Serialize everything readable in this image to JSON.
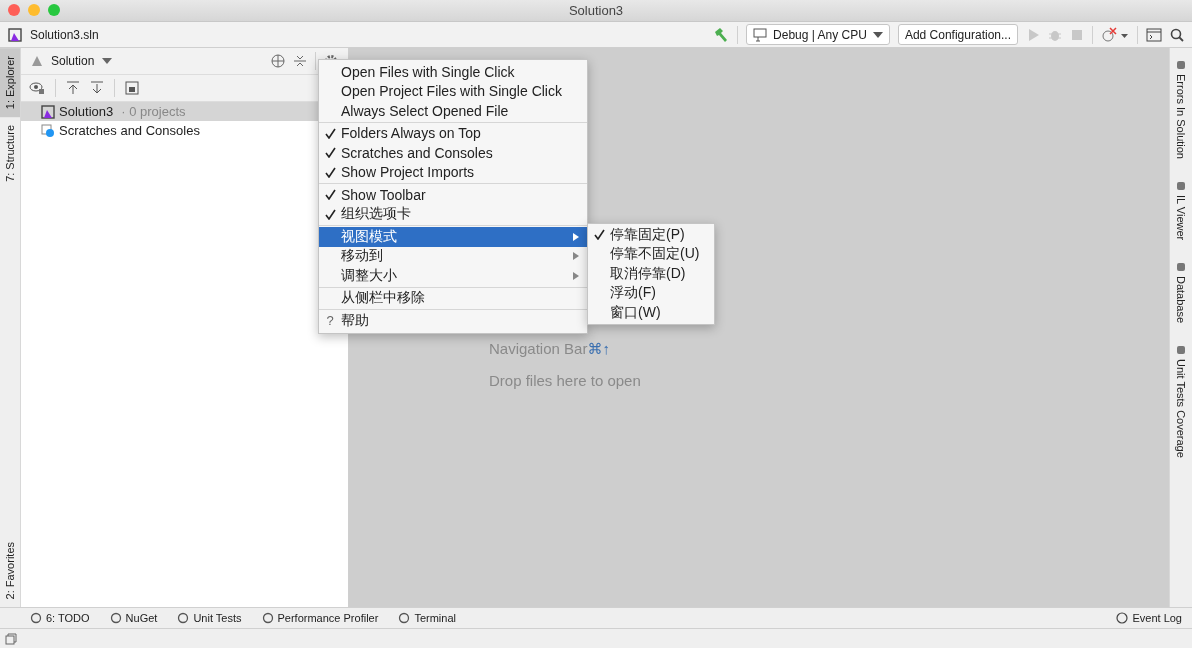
{
  "window": {
    "title": "Solution3"
  },
  "toolbar": {
    "file": "Solution3.sln",
    "configuration": "Debug | Any CPU",
    "add_configuration": "Add Configuration..."
  },
  "left_strip": {
    "top": [
      {
        "label": "1: Explorer",
        "selected": true
      },
      {
        "label": "7: Structure",
        "selected": false
      }
    ],
    "bottom": [
      {
        "label": "2: Favorites",
        "selected": false
      }
    ]
  },
  "explorer": {
    "header": "Solution",
    "tree": [
      {
        "label": "Solution3",
        "detail": "· 0 projects",
        "selected": true
      },
      {
        "label": "Scratches and Consoles",
        "selected": false
      }
    ]
  },
  "menu": {
    "groups": [
      [
        {
          "label": "Open Files with Single Click",
          "checked": false,
          "selected": false,
          "submenu": false
        },
        {
          "label": "Open Project Files with Single Click",
          "checked": false,
          "selected": false,
          "submenu": false
        },
        {
          "label": "Always Select Opened File",
          "checked": false,
          "selected": false,
          "submenu": false
        }
      ],
      [
        {
          "label": "Folders Always on Top",
          "checked": true,
          "selected": false,
          "submenu": false
        },
        {
          "label": "Scratches and Consoles",
          "checked": true,
          "selected": false,
          "submenu": false
        },
        {
          "label": "Show Project Imports",
          "checked": true,
          "selected": false,
          "submenu": false
        }
      ],
      [
        {
          "label": "Show Toolbar",
          "checked": true,
          "selected": false,
          "submenu": false
        },
        {
          "label": "组织选项卡",
          "checked": true,
          "selected": false,
          "submenu": false
        }
      ],
      [
        {
          "label": "视图模式",
          "checked": false,
          "selected": true,
          "submenu": true
        },
        {
          "label": "移动到",
          "checked": false,
          "selected": false,
          "submenu": true
        },
        {
          "label": "调整大小",
          "checked": false,
          "selected": false,
          "submenu": true
        }
      ],
      [
        {
          "label": "从侧栏中移除",
          "checked": false,
          "selected": false,
          "submenu": false
        }
      ],
      [
        {
          "label": "帮助",
          "prefix": "?",
          "checked": false,
          "selected": false,
          "submenu": false
        }
      ]
    ]
  },
  "submenu": [
    {
      "label": "停靠固定(P)",
      "checked": true
    },
    {
      "label": "停靠不固定(U)",
      "checked": false
    },
    {
      "label": "取消停靠(D)",
      "checked": false
    },
    {
      "label": "浮动(F)",
      "checked": false
    },
    {
      "label": "窗口(W)",
      "checked": false
    }
  ],
  "editor": {
    "hints": [
      {
        "text": "Navigation Bar",
        "shortcut": "⌘↑"
      },
      {
        "text": "Drop files here to open"
      }
    ]
  },
  "right_strip": [
    {
      "label": "Errors In Solution"
    },
    {
      "label": "IL Viewer"
    },
    {
      "label": "Database"
    },
    {
      "label": "Unit Tests Coverage"
    }
  ],
  "bottom_tools": [
    {
      "label": "6: TODO"
    },
    {
      "label": "NuGet"
    },
    {
      "label": "Unit Tests"
    },
    {
      "label": "Performance Profiler"
    },
    {
      "label": "Terminal"
    }
  ],
  "event_log": "Event Log"
}
